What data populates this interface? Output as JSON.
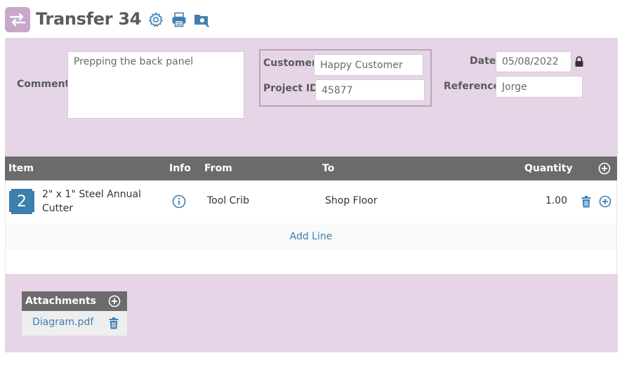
{
  "header": {
    "title": "Transfer 34",
    "app_icon": "swap-arrows-icon",
    "tools": [
      "gear-icon",
      "printer-icon",
      "folder-search-icon"
    ]
  },
  "form": {
    "comment_label": "Comment",
    "comment_value": "Prepping the back panel",
    "customer_label": "Customer",
    "customer_value": "Happy Customer",
    "project_label": "Project ID",
    "project_value": "45877",
    "date_label": "Date",
    "date_value": "05/08/2022",
    "reference_label": "Reference",
    "reference_value": "Jorge"
  },
  "table": {
    "columns": {
      "item": "Item",
      "info": "Info",
      "from": "From",
      "to": "To",
      "quantity": "Quantity"
    },
    "rows": [
      {
        "badge": "2",
        "item": "2\" x 1\" Steel Annual Cutter",
        "item_line1": "2\" x 1\" Steel Annual",
        "item_line2": "Cutter",
        "from": "Tool Crib",
        "to": "Shop Floor",
        "quantity": "1.00"
      }
    ],
    "add_line_label": "Add Line"
  },
  "attachments": {
    "title": "Attachments",
    "files": [
      {
        "name": "Diagram.pdf"
      }
    ]
  },
  "colors": {
    "accent_purple": "#c9a7cb",
    "panel_bg": "#e6d5e6",
    "header_gray": "#6b6b6b",
    "link_blue": "#3f7fb1",
    "badge_blue": "#3c7fad"
  }
}
